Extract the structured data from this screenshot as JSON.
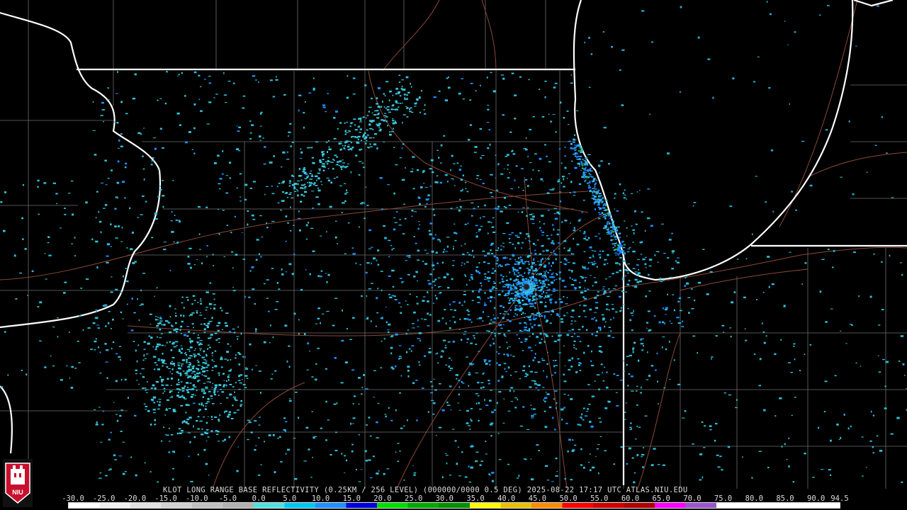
{
  "product": {
    "caption": "KLOT LONG RANGE BASE REFLECTIVITY (0.25KM / 256 LEVEL) (000000/0000 0.5 DEG) 2025-08-22 17:17 UTC  ATLAS.NIU.EDU"
  },
  "legend": {
    "ticks": [
      "-30.0",
      "-25.0",
      "-20.0",
      "-15.0",
      "-10.0",
      "-5.0",
      "0.0",
      "5.0",
      "10.0",
      "15.0",
      "20.0",
      "25.0",
      "30.0",
      "35.0",
      "40.0",
      "45.0",
      "50.0",
      "55.0",
      "60.0",
      "65.0",
      "70.0",
      "75.0",
      "80.0",
      "85.0",
      "90.0",
      "94.5"
    ],
    "colors": [
      "#ffffff",
      "#f0f0f0",
      "#e0e0e0",
      "#d0d0d0",
      "#c0c0c0",
      "#b0b0b0",
      "#50e0e0",
      "#00c8f0",
      "#1e90ff",
      "#0000dd",
      "#00dd00",
      "#00aa00",
      "#009000",
      "#ffff00",
      "#e8c000",
      "#ff8c00",
      "#ff0000",
      "#d00000",
      "#b00000",
      "#ff00ff",
      "#9955cc",
      "#ffffff",
      "#ffffff",
      "#ffffff",
      "#ffffff"
    ]
  },
  "logo": {
    "text": "NIU"
  }
}
